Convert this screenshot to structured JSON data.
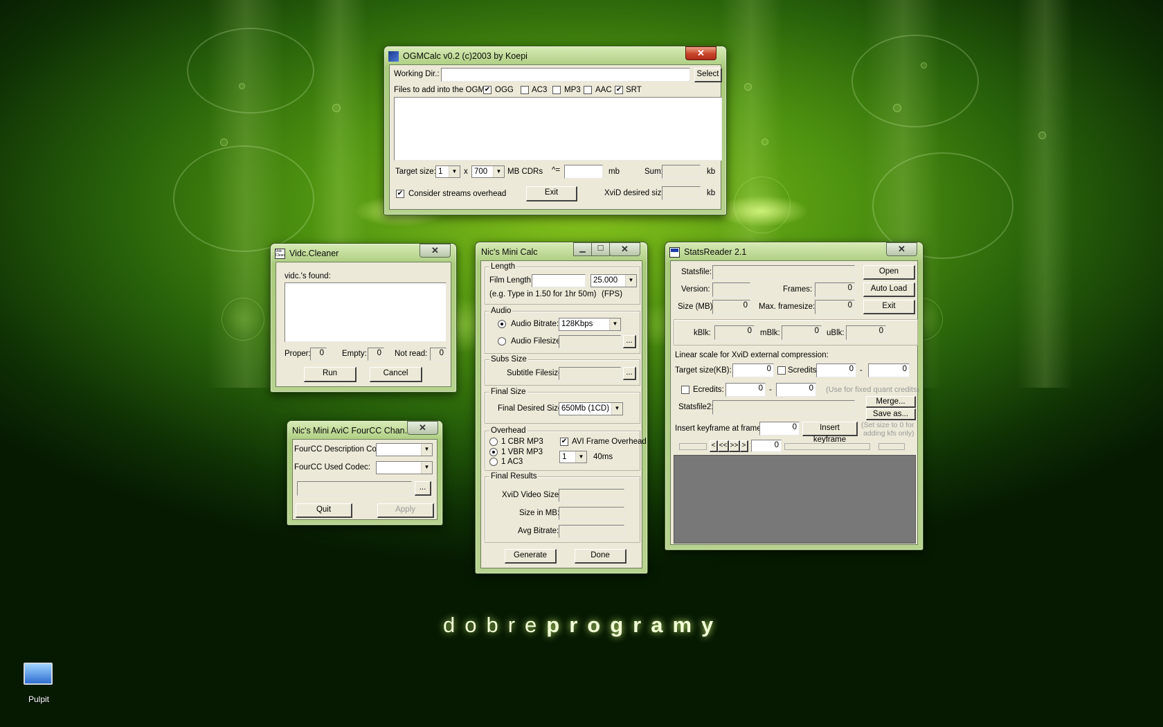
{
  "desktop": {
    "brand_light": "dobre",
    "brand_bold": "programy",
    "icon_label": "Pulpit",
    "accent": "#6fb116"
  },
  "ogmcalc": {
    "title": "OGMCalc v0.2 (c)2003 by Koepi",
    "close": "✕",
    "working_dir_label": "Working Dir.:",
    "working_dir_value": "",
    "select_btn": "Select",
    "files_label": "Files to add into the OGM:",
    "file_types": [
      {
        "label": "OGG",
        "checked": "✔"
      },
      {
        "label": "AC3",
        "checked": ""
      },
      {
        "label": "MP3",
        "checked": ""
      },
      {
        "label": "AAC",
        "checked": ""
      },
      {
        "label": "SRT",
        "checked": "✔"
      }
    ],
    "target_size_label": "Target size:",
    "target_count": "1",
    "times": "x",
    "cd_size": "700",
    "cd_unit": "MB CDRs",
    "approx": "^=",
    "mb_unit": "mb",
    "sum_label": "Sum:",
    "kb_unit": "kb",
    "consider_overhead": "Consider streams overhead",
    "consider_checked": "✔",
    "exit_btn": "Exit",
    "xvid_label": "XviD desired size:",
    "kb_unit2": "kb"
  },
  "vidc": {
    "title": "Vidc.Cleaner",
    "icon_text": "Vidc Clean",
    "close": "✕",
    "found_label": "vidc.'s found:",
    "proper_label": "Proper:",
    "proper_value": "0",
    "empty_label": "Empty:",
    "empty_value": "0",
    "notread_label": "Not read:",
    "notread_value": "0",
    "run_btn": "Run",
    "cancel_btn": "Cancel"
  },
  "fourcc": {
    "title": "Nic's Mini AviC FourCC Chan...",
    "close": "✕",
    "desc_label": "FourCC Description Code:",
    "used_label": "FourCC Used Codec:",
    "browse_btn": "...",
    "quit_btn": "Quit",
    "apply_btn": "Apply"
  },
  "minicalc": {
    "title": "Nic's Mini Calc",
    "min": "▁",
    "max": "☐",
    "close": "✕",
    "length_group": "Length",
    "film_length_label": "Film Length:",
    "fps_value": "25.000",
    "hint": "(e.g. Type in 1.50 for 1hr 50m)",
    "fps_label": "(FPS)",
    "audio_group": "Audio",
    "audio_bitrate_label": "Audio Bitrate:",
    "audio_bitrate_value": "128Kbps",
    "audio_filesize_label": "Audio Filesize:",
    "browse": "...",
    "subs_group": "Subs Size",
    "subtitle_label": "Subtitle Filesize:",
    "final_size_group": "Final Size",
    "final_desired_label": "Final Desired Size:",
    "final_desired_value": "650Mb (1CD)",
    "overhead_group": "Overhead",
    "opt_cbr": "1 CBR MP3",
    "opt_vbr": "1 VBR MP3",
    "opt_ac3": "1 AC3",
    "avi_overhead": "AVI Frame Overhead",
    "avi_checked": "✔",
    "frames_value": "1",
    "ms_label": "40ms",
    "results_group": "Final Results",
    "xvid_size_label": "XviD Video Size:",
    "size_mb_label": "Size in MB:",
    "avg_bitrate_label": "Avg Bitrate:",
    "generate_btn": "Generate",
    "done_btn": "Done"
  },
  "stats": {
    "title": "StatsReader 2.1",
    "close": "✕",
    "statsfile_label": "Statsfile:",
    "open_btn": "Open",
    "version_label": "Version:",
    "frames_label": "Frames:",
    "frames_value": "0",
    "autoload_btn": "Auto Load",
    "sizemb_label": "Size (MB):",
    "sizemb_value": "0",
    "maxframe_label": "Max. framesize:",
    "maxframe_value": "0",
    "exit_btn": "Exit",
    "kblk_label": "kBlk:",
    "kblk_value": "0",
    "mblk_label": "mBlk:",
    "mblk_value": "0",
    "ublk_label": "uBlk:",
    "ublk_value": "0",
    "linear_label": "Linear scale for XviD external compression:",
    "target_label": "Target size(KB):",
    "target_value": "0",
    "scredits_label": "Scredits:",
    "scredits_from": "0",
    "dash": "-",
    "scredits_to": "0",
    "ecredits_label": "Ecredits:",
    "ecredits_from": "0",
    "ecredits_to": "0",
    "fixed_hint": "(Use for fixed quant credits)",
    "statsfile2_label": "Statsfile2:",
    "merge_btn": "Merge...",
    "saveas_btn": "Save as...",
    "insert_label": "Insert keyframe at frame:",
    "insert_value": "0",
    "insert_btn": "Insert keyframe",
    "set_hint_1": "(Set size to 0 for",
    "set_hint_2": "adding kfs only)",
    "nav_first": "<",
    "nav_prev": "<<",
    "nav_next": ">>",
    "nav_last": ">",
    "nav_frame": "0"
  }
}
